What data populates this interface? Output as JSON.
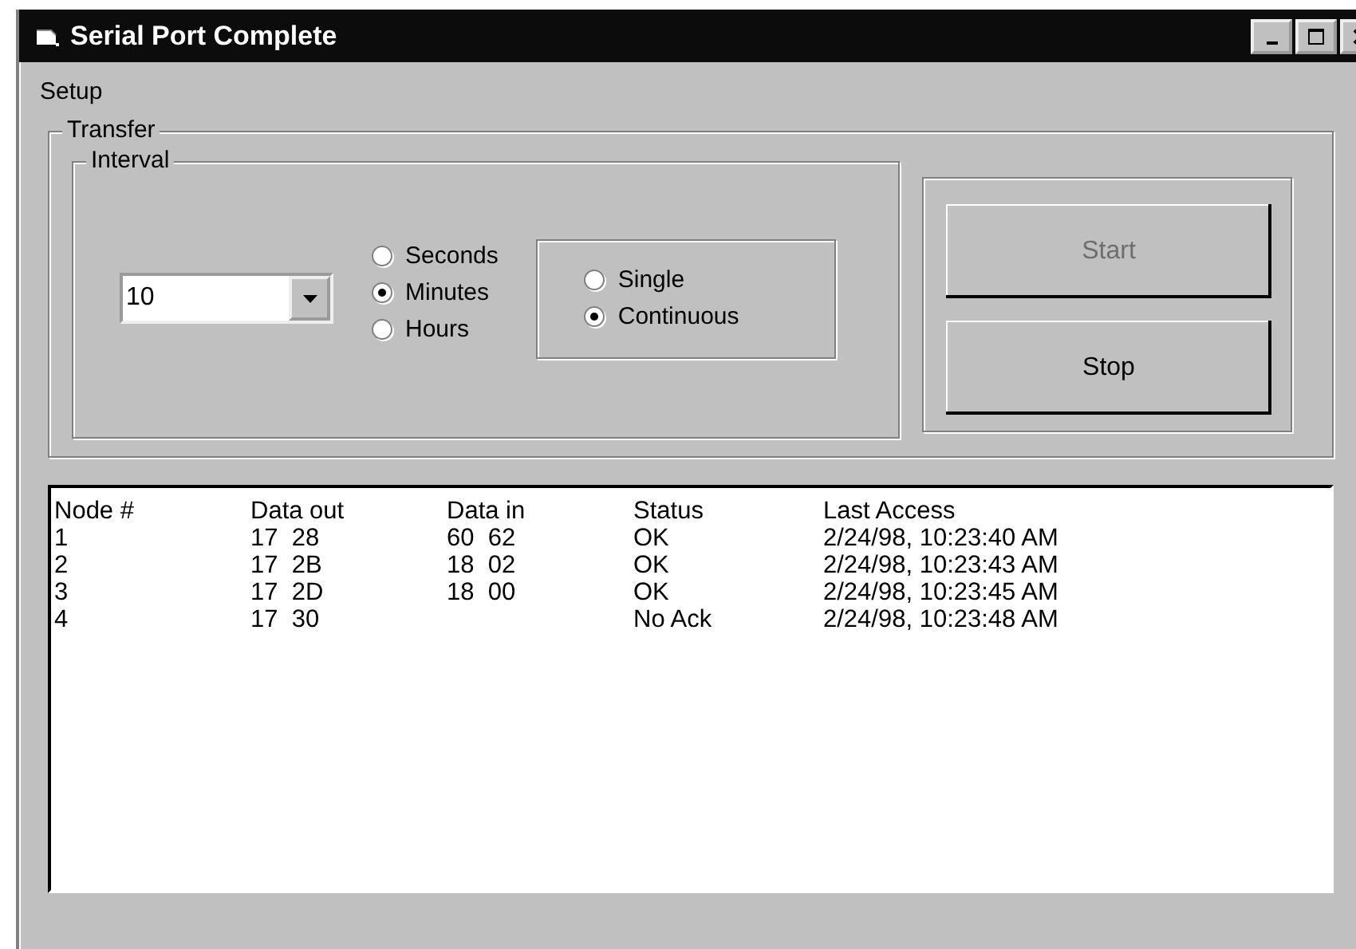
{
  "window": {
    "title": "Serial Port Complete"
  },
  "menu": [
    {
      "label": "Setup"
    }
  ],
  "transfer": {
    "label": "Transfer",
    "interval": {
      "label": "Interval",
      "value": "10",
      "units": [
        {
          "label": "Seconds",
          "selected": false
        },
        {
          "label": "Minutes",
          "selected": true
        },
        {
          "label": "Hours",
          "selected": false
        }
      ]
    },
    "modes": [
      {
        "label": "Single",
        "selected": false
      },
      {
        "label": "Continuous",
        "selected": true
      }
    ],
    "buttons": [
      {
        "label": "Start",
        "disabled": true
      },
      {
        "label": "Stop",
        "disabled": false
      }
    ]
  },
  "log": {
    "columns": [
      "Node #",
      "Data out",
      "Data in",
      "Status",
      "Last Access"
    ],
    "rows": [
      [
        "1",
        "17  28",
        "60  62",
        "OK",
        "2/24/98, 10:23:40 AM"
      ],
      [
        "2",
        "17  2B",
        "18  02",
        "OK",
        "2/24/98, 10:23:43 AM"
      ],
      [
        "3",
        "17  2D",
        "18  00",
        "OK",
        "2/24/98, 10:23:45 AM"
      ],
      [
        "4",
        "17  30",
        "",
        "No Ack",
        "2/24/98, 10:23:48 AM"
      ]
    ]
  }
}
